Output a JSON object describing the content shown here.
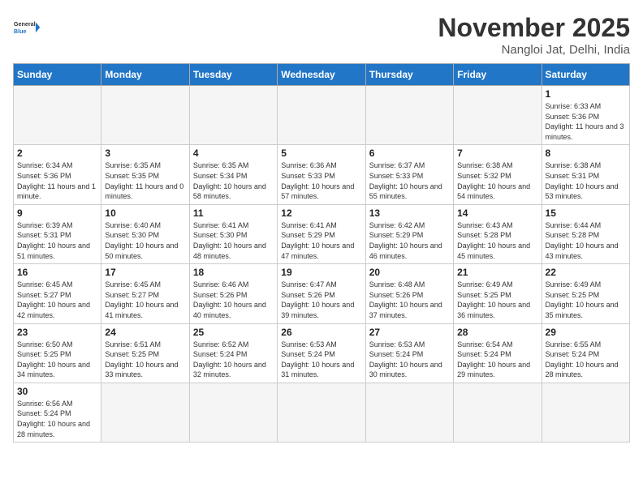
{
  "header": {
    "logo_general": "General",
    "logo_blue": "Blue",
    "month_title": "November 2025",
    "location": "Nangloi Jat, Delhi, India"
  },
  "days_of_week": [
    "Sunday",
    "Monday",
    "Tuesday",
    "Wednesday",
    "Thursday",
    "Friday",
    "Saturday"
  ],
  "weeks": [
    [
      {
        "day": "",
        "info": ""
      },
      {
        "day": "",
        "info": ""
      },
      {
        "day": "",
        "info": ""
      },
      {
        "day": "",
        "info": ""
      },
      {
        "day": "",
        "info": ""
      },
      {
        "day": "",
        "info": ""
      },
      {
        "day": "1",
        "info": "Sunrise: 6:33 AM\nSunset: 5:36 PM\nDaylight: 11 hours\nand 3 minutes."
      }
    ],
    [
      {
        "day": "2",
        "info": "Sunrise: 6:34 AM\nSunset: 5:36 PM\nDaylight: 11 hours\nand 1 minute."
      },
      {
        "day": "3",
        "info": "Sunrise: 6:35 AM\nSunset: 5:35 PM\nDaylight: 11 hours\nand 0 minutes."
      },
      {
        "day": "4",
        "info": "Sunrise: 6:35 AM\nSunset: 5:34 PM\nDaylight: 10 hours\nand 58 minutes."
      },
      {
        "day": "5",
        "info": "Sunrise: 6:36 AM\nSunset: 5:33 PM\nDaylight: 10 hours\nand 57 minutes."
      },
      {
        "day": "6",
        "info": "Sunrise: 6:37 AM\nSunset: 5:33 PM\nDaylight: 10 hours\nand 55 minutes."
      },
      {
        "day": "7",
        "info": "Sunrise: 6:38 AM\nSunset: 5:32 PM\nDaylight: 10 hours\nand 54 minutes."
      },
      {
        "day": "8",
        "info": "Sunrise: 6:38 AM\nSunset: 5:31 PM\nDaylight: 10 hours\nand 53 minutes."
      }
    ],
    [
      {
        "day": "9",
        "info": "Sunrise: 6:39 AM\nSunset: 5:31 PM\nDaylight: 10 hours\nand 51 minutes."
      },
      {
        "day": "10",
        "info": "Sunrise: 6:40 AM\nSunset: 5:30 PM\nDaylight: 10 hours\nand 50 minutes."
      },
      {
        "day": "11",
        "info": "Sunrise: 6:41 AM\nSunset: 5:30 PM\nDaylight: 10 hours\nand 48 minutes."
      },
      {
        "day": "12",
        "info": "Sunrise: 6:41 AM\nSunset: 5:29 PM\nDaylight: 10 hours\nand 47 minutes."
      },
      {
        "day": "13",
        "info": "Sunrise: 6:42 AM\nSunset: 5:29 PM\nDaylight: 10 hours\nand 46 minutes."
      },
      {
        "day": "14",
        "info": "Sunrise: 6:43 AM\nSunset: 5:28 PM\nDaylight: 10 hours\nand 45 minutes."
      },
      {
        "day": "15",
        "info": "Sunrise: 6:44 AM\nSunset: 5:28 PM\nDaylight: 10 hours\nand 43 minutes."
      }
    ],
    [
      {
        "day": "16",
        "info": "Sunrise: 6:45 AM\nSunset: 5:27 PM\nDaylight: 10 hours\nand 42 minutes."
      },
      {
        "day": "17",
        "info": "Sunrise: 6:45 AM\nSunset: 5:27 PM\nDaylight: 10 hours\nand 41 minutes."
      },
      {
        "day": "18",
        "info": "Sunrise: 6:46 AM\nSunset: 5:26 PM\nDaylight: 10 hours\nand 40 minutes."
      },
      {
        "day": "19",
        "info": "Sunrise: 6:47 AM\nSunset: 5:26 PM\nDaylight: 10 hours\nand 39 minutes."
      },
      {
        "day": "20",
        "info": "Sunrise: 6:48 AM\nSunset: 5:26 PM\nDaylight: 10 hours\nand 37 minutes."
      },
      {
        "day": "21",
        "info": "Sunrise: 6:49 AM\nSunset: 5:25 PM\nDaylight: 10 hours\nand 36 minutes."
      },
      {
        "day": "22",
        "info": "Sunrise: 6:49 AM\nSunset: 5:25 PM\nDaylight: 10 hours\nand 35 minutes."
      }
    ],
    [
      {
        "day": "23",
        "info": "Sunrise: 6:50 AM\nSunset: 5:25 PM\nDaylight: 10 hours\nand 34 minutes."
      },
      {
        "day": "24",
        "info": "Sunrise: 6:51 AM\nSunset: 5:25 PM\nDaylight: 10 hours\nand 33 minutes."
      },
      {
        "day": "25",
        "info": "Sunrise: 6:52 AM\nSunset: 5:24 PM\nDaylight: 10 hours\nand 32 minutes."
      },
      {
        "day": "26",
        "info": "Sunrise: 6:53 AM\nSunset: 5:24 PM\nDaylight: 10 hours\nand 31 minutes."
      },
      {
        "day": "27",
        "info": "Sunrise: 6:53 AM\nSunset: 5:24 PM\nDaylight: 10 hours\nand 30 minutes."
      },
      {
        "day": "28",
        "info": "Sunrise: 6:54 AM\nSunset: 5:24 PM\nDaylight: 10 hours\nand 29 minutes."
      },
      {
        "day": "29",
        "info": "Sunrise: 6:55 AM\nSunset: 5:24 PM\nDaylight: 10 hours\nand 28 minutes."
      }
    ],
    [
      {
        "day": "30",
        "info": "Sunrise: 6:56 AM\nSunset: 5:24 PM\nDaylight: 10 hours\nand 28 minutes."
      },
      {
        "day": "",
        "info": ""
      },
      {
        "day": "",
        "info": ""
      },
      {
        "day": "",
        "info": ""
      },
      {
        "day": "",
        "info": ""
      },
      {
        "day": "",
        "info": ""
      },
      {
        "day": "",
        "info": ""
      }
    ]
  ]
}
